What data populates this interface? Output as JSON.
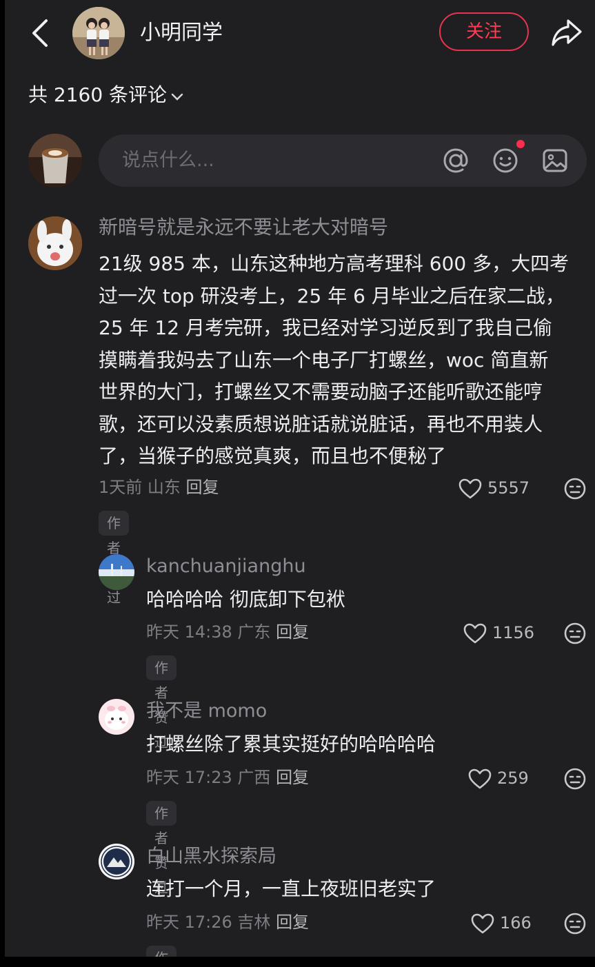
{
  "header": {
    "author_name": "小明同学",
    "follow_label": "关注",
    "back_icon": "chevron-left-icon",
    "share_icon": "share-icon"
  },
  "comments_count_label": "共 2160 条评论",
  "composer": {
    "placeholder": "说点什么...",
    "icons": [
      "at-icon",
      "emoji-icon",
      "image-icon"
    ]
  },
  "colors": {
    "background": "#1f1f22",
    "accent": "#ff3b55",
    "input_bg": "#2c2c30",
    "badge_bg": "#2e2e33"
  },
  "comments": [
    {
      "username": "新暗号就是永远不要让老大对暗号",
      "text_lines": [
        "21级 985 本，山东这种地方高考理科 600 多，大四考",
        "过一次 top 研没考上，25 年 6 月毕业之后在家二战，",
        "25 年 12 月考完研，我已经对学习逆反到了我自己偷",
        "摸瞒着我妈去了山东一个电子厂打螺丝，woc 简直新",
        "世界的大门，打螺丝又不需要动脑子还能听歌还能哼",
        "歌，还可以没素质想说脏话就说脏话，再也不用装人",
        "了，当猴子的感觉真爽，而且也不便秘了"
      ],
      "time_location": "1天前 山东",
      "reply_label": "回复",
      "likes": "5557",
      "badge": "作者赞过",
      "replies": [
        {
          "username": "kanchuanjianghu",
          "text": "哈哈哈哈 彻底卸下包袱",
          "time_location": "昨天 14:38 广东",
          "reply_label": "回复",
          "likes": "1156",
          "badge": "作者赞过"
        },
        {
          "username": "我不是 momo",
          "text": "打螺丝除了累其实挺好的哈哈哈哈",
          "time_location": "昨天 17:23 广西",
          "reply_label": "回复",
          "likes": "259",
          "badge": "作者赞过"
        },
        {
          "username": "白山黑水探索局",
          "text": "连打一个月，一直上夜班旧老实了",
          "time_location": "昨天 17:26 吉林",
          "reply_label": "回复",
          "likes": "166",
          "badge": "作者赞过"
        }
      ]
    }
  ]
}
